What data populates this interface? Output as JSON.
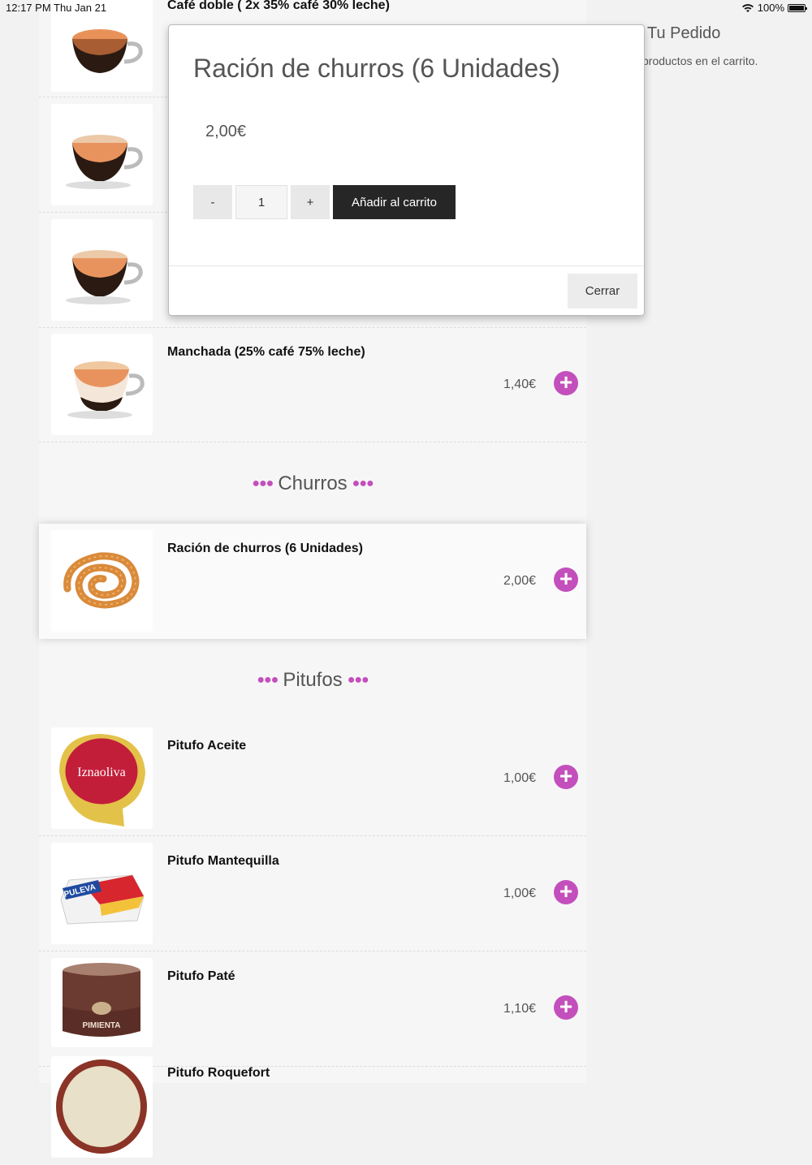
{
  "status_bar": {
    "time": "12:17 PM",
    "date": "Thu Jan 21",
    "battery": "100%"
  },
  "menu": {
    "top_cut_title": "Café doble ( 2x 35% café 30% leche)",
    "products_top": [
      {
        "name": "",
        "image": "coffee-cup-icon"
      },
      {
        "name": "",
        "image": "coffee-cup-icon"
      },
      {
        "name": "",
        "image": "coffee-cup-icon"
      }
    ],
    "manchada": {
      "name": "Manchada (25% café 75% leche)",
      "price": "1,40€",
      "image": "coffee-cup-icon"
    },
    "section_churros": "Churros",
    "churros": {
      "name": "Ración de churros (6 Unidades)",
      "price": "2,00€",
      "image": "churro-icon"
    },
    "section_pitufos": "Pitufos",
    "pitufos": [
      {
        "name": "Pitufo Aceite",
        "price": "1,00€",
        "image": "olive-oil-pack-icon"
      },
      {
        "name": "Pitufo Mantequilla",
        "price": "1,00€",
        "image": "butter-pack-icon"
      },
      {
        "name": "Pitufo Paté",
        "price": "1,10€",
        "image": "pate-tin-icon"
      },
      {
        "name": "Pitufo Roquefort",
        "price": "",
        "image": "roquefort-tin-icon"
      }
    ],
    "add_icon": "+"
  },
  "order": {
    "title": "Tu Pedido",
    "empty_text": "productos en el carrito."
  },
  "modal": {
    "title": "Ración de churros (6 Unidades)",
    "price": "2,00€",
    "minus": "-",
    "quantity": "1",
    "plus": "+",
    "add_to_cart": "Añadir al carrito",
    "close": "Cerrar"
  },
  "colors": {
    "accent": "#c34fbc",
    "dark_button": "#262626"
  }
}
